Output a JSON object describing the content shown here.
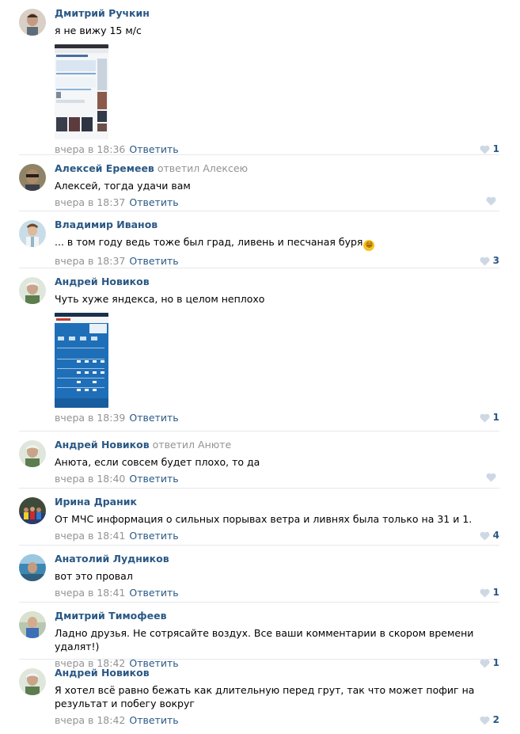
{
  "comments": [
    {
      "author": "Дмитрий Ручкин",
      "reply_prefix": "",
      "reply_to": "",
      "text": "я не вижу 15 м/с",
      "date": "вчера в 18:36",
      "reply_label": "Ответить",
      "likes": "1",
      "avatar_color": "#c6b4a2"
    },
    {
      "author": "Алексей Еремеев",
      "reply_prefix": "ответил",
      "reply_to": "Алексею",
      "text": "Алексей, тогда удачи вам",
      "date": "вчера в 18:37",
      "reply_label": "Ответить",
      "likes": "",
      "avatar_color": "#8a7a5e"
    },
    {
      "author": "Владимир Иванов",
      "reply_prefix": "",
      "reply_to": "",
      "text": "... в том году ведь тоже был град, ливень и песчаная буря",
      "emoji": "😁",
      "date": "вчера в 18:37",
      "reply_label": "Ответить",
      "likes": "3",
      "avatar_color": "#b8d0de"
    },
    {
      "author": "Андрей Новиков",
      "reply_prefix": "",
      "reply_to": "",
      "text": "Чуть хуже яндекса, но в целом неплохо",
      "date": "вчера в 18:39",
      "reply_label": "Ответить",
      "likes": "1",
      "avatar_color": "#9fae8f"
    },
    {
      "author": "Андрей Новиков",
      "reply_prefix": "ответил",
      "reply_to": "Анюте",
      "text": "Анюта, если совсем будет плохо, то да",
      "date": "вчера в 18:40",
      "reply_label": "Ответить",
      "likes": "",
      "avatar_color": "#9fae8f"
    },
    {
      "author": "Ирина Драник",
      "reply_prefix": "",
      "reply_to": "",
      "text": "От МЧС информация о сильных порывах ветра и ливнях была только на 31 и 1.",
      "date": "вчера в 18:41",
      "reply_label": "Ответить",
      "likes": "4",
      "avatar_color": "#3e4a3a"
    },
    {
      "author": "Анатолий Лудников",
      "reply_prefix": "",
      "reply_to": "",
      "text": "вот это провал",
      "date": "вчера в 18:41",
      "reply_label": "Ответить",
      "likes": "1",
      "avatar_color": "#4f8fb0"
    },
    {
      "author": "Дмитрий Тимофеев",
      "reply_prefix": "",
      "reply_to": "",
      "text": "Ладно друзья. Не сотрясайте воздух. Все ваши комментарии в скором времени удалят!)",
      "date": "вчера в 18:42",
      "reply_label": "Ответить",
      "likes": "1",
      "avatar_color": "#a7b9a0"
    },
    {
      "author": "Андрей Новиков",
      "reply_prefix": "",
      "reply_to": "",
      "text": "Я хотел всё равно бежать как длительную перед грут, так что может пофиг на результат и побегу вокруг",
      "date": "вчера в 18:42",
      "reply_label": "Ответить",
      "likes": "2",
      "avatar_color": "#9fae8f"
    }
  ],
  "colors": {
    "link": "#2a5885",
    "meta": "#939393",
    "divider": "#e7e8ec",
    "heart": "#cdd8e4"
  }
}
